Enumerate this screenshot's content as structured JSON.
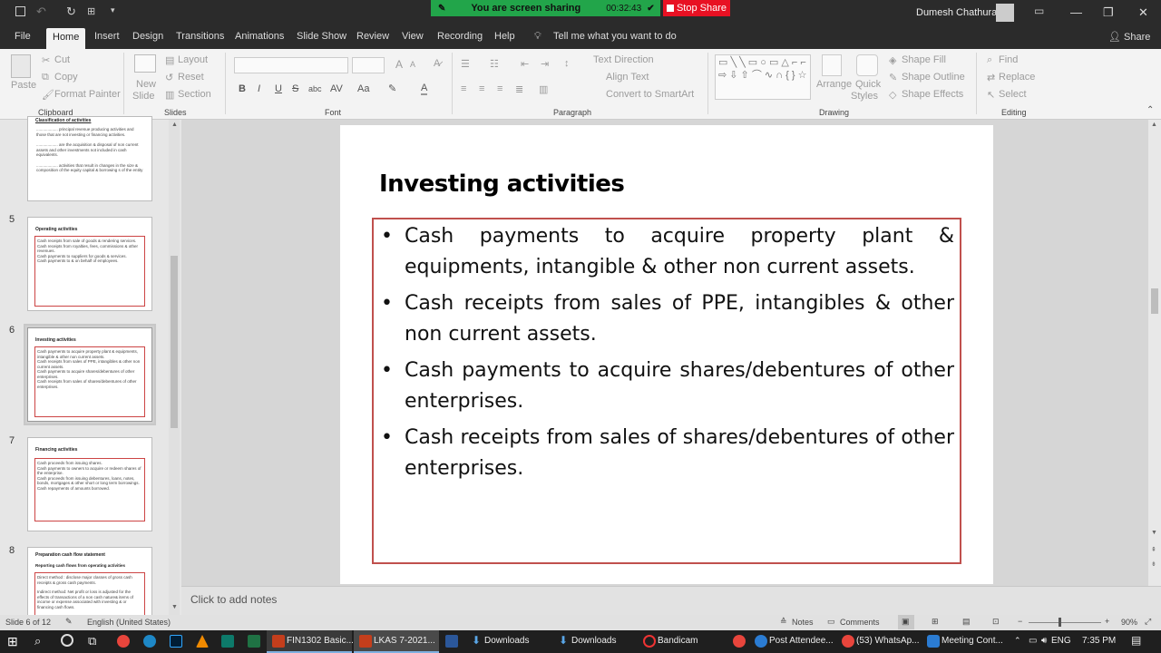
{
  "titlebar": {
    "user_name": "Dumesh Chathura",
    "share_banner": "You are screen sharing",
    "share_timer": "00:32:43",
    "stop_share": "Stop Share"
  },
  "menu": {
    "tabs": [
      "File",
      "Home",
      "Insert",
      "Design",
      "Transitions",
      "Animations",
      "Slide Show",
      "Review",
      "View",
      "Recording",
      "Help"
    ],
    "tell_me": "Tell me what you want to do",
    "share": "Share"
  },
  "ribbon": {
    "clipboard": {
      "paste": "Paste",
      "cut": "Cut",
      "copy": "Copy",
      "format_painter": "Format Painter",
      "group": "Clipboard"
    },
    "slides": {
      "new_slide_1": "New",
      "new_slide_2": "Slide",
      "layout": "Layout",
      "reset": "Reset",
      "section": "Section",
      "group": "Slides"
    },
    "font": {
      "bold": "B",
      "italic": "I",
      "underline": "U",
      "strike": "S",
      "shadow": "abc",
      "spacing": "AV",
      "case": "Aa",
      "font_color": "A",
      "grow": "A",
      "shrink": "A",
      "group": "Font"
    },
    "paragraph": {
      "text_direction": "Text Direction",
      "align_text": "Align Text",
      "convert_smartart": "Convert to SmartArt",
      "group": "Paragraph"
    },
    "drawing": {
      "arrange": "Arrange",
      "quick_styles_1": "Quick",
      "quick_styles_2": "Styles",
      "shape_fill": "Shape Fill",
      "shape_outline": "Shape Outline",
      "shape_effects": "Shape Effects",
      "group": "Drawing"
    },
    "editing": {
      "find": "Find",
      "replace": "Replace",
      "select": "Select",
      "group": "Editing"
    }
  },
  "thumbnails": {
    "slide4": {
      "title": "Classification of activities",
      "lines": [
        "................... principal revenue producing activities and those that are not investing or financing activities.",
        "................... are the acquisition & disposal of non current assets and other investments not included in cash equivalents.",
        "................... activities that result in changes in the size & composition of the equity capital & borrowing s of the entity"
      ]
    },
    "slide5": {
      "num": "5",
      "title": "Operating activities",
      "lines": [
        "Cash receipts from sale of goods & rendering services.",
        "Cash receipts from royalties, fees, commissions & other revenues.",
        "Cash payments to suppliers for goods & services.",
        "Cash payments to & on behalf of employees."
      ]
    },
    "slide6": {
      "num": "6",
      "title": "Investing activities",
      "lines": [
        "Cash payments to acquire property plant & equipments, intangible & other non current assets.",
        "Cash receipts from sales of PPE, intangibles & other non current assets.",
        "Cash payments to acquire shares/debentures of other enterprises.",
        "Cash receipts from sales of shares/debentures of other enterprises."
      ]
    },
    "slide7": {
      "num": "7",
      "title": "Financing activities",
      "lines": [
        "Cash proceeds from issuing shares.",
        "Cash payments to owners to acquire or redeem shares of the enterprise.",
        "Cash proceeds from issuing debentures, loans, notes, bonds, mortgages & other short or long term borrowings.",
        "Cash repayments of amounts borrowed."
      ]
    },
    "slide8": {
      "num": "8",
      "title": "Preparation cash flow statement",
      "subtitle": "Reporting cash flows from operating activities",
      "lines": [
        "Direct method : disclose major classes of gross cash receipts & gross cash payments.",
        "Indirect method: Net profit or loss is adjusted for the effects of transactions of a non cash nature& items of income or expense associated with investing & or financing cash flows."
      ]
    }
  },
  "slide": {
    "title": "Investing activities",
    "bullets": [
      "Cash payments to acquire property plant & equipments, intangible & other non current assets.",
      "Cash receipts from sales of PPE, intangibles & other non current assets.",
      "Cash payments to acquire shares/debentures of other enterprises.",
      "Cash receipts from sales of shares/debentures of other enterprises."
    ]
  },
  "notes_placeholder": "Click to add notes",
  "status": {
    "slide_info": "Slide 6 of 12",
    "language": "English (United States)",
    "notes": "Notes",
    "comments": "Comments",
    "zoom": "90%"
  },
  "taskbar": {
    "apps": [
      "FIN1302 Basic...",
      "LKAS 7-2021...",
      "Downloads",
      "Downloads",
      "Bandicam",
      "Post Attendee...",
      "(53) WhatsAp...",
      "Meeting Cont..."
    ],
    "language": "ENG",
    "time": "7:35 PM"
  },
  "colors": {
    "accent": "#c0504d",
    "share_green": "#22a54a",
    "stop_red": "#e81123"
  }
}
